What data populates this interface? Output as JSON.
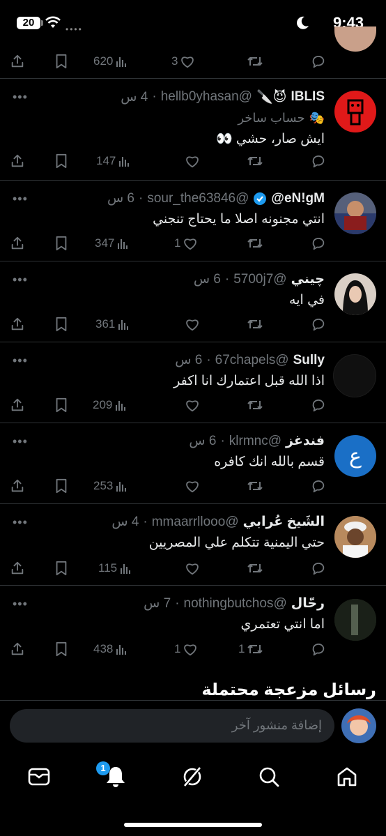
{
  "status_bar": {
    "battery": "20",
    "time": "9:43"
  },
  "tweets": [
    {
      "display_name": "IBLIS",
      "emoji": "😈🔪",
      "handle": "@hellb0yhasan",
      "time": "4 س",
      "sub_emoji": "🎭",
      "sub_text": "حساب ساخر",
      "text": "ايش صار، حشي 👀",
      "views": "147",
      "likes": "",
      "retweets": "",
      "avatar_color": "#e01919"
    },
    {
      "display_name": "eN!gM@",
      "handle": "@sour_the63846",
      "time": "6 س",
      "verified": true,
      "text": "انتي مجنونه اصلا ما يحتاج تنجني",
      "views": "347",
      "likes": "1",
      "retweets": "",
      "avatar_color": "#56607a"
    },
    {
      "display_name": "چيني",
      "handle": "@5700j7",
      "time": "6 س",
      "text": "في ايه",
      "views": "361",
      "likes": "",
      "retweets": "",
      "avatar_color": "#d9cfc6"
    },
    {
      "display_name": "Sully",
      "handle": "@67chapels",
      "time": "6 س",
      "text": "اذا الله قبل اعتمارك انا اكفر",
      "views": "209",
      "likes": "",
      "retweets": "",
      "avatar_color": "#101010"
    },
    {
      "display_name": "فندغز",
      "handle": "@klrmnc",
      "time": "6 س",
      "avatar_letter": "ع",
      "text": "قسم بالله انك كافره",
      "views": "253",
      "likes": "",
      "retweets": "",
      "avatar_color": "#1a6fc6"
    },
    {
      "display_name": "الشَيخ عُرابي",
      "handle": "@mmaarrllooo",
      "time": "4 س",
      "text": "حتي اليمنية تتكلم علي المصريين",
      "views": "115",
      "likes": "",
      "retweets": "",
      "avatar_color": "#8c6a4c"
    },
    {
      "display_name": "رحّال",
      "handle": "@nothingbutchos",
      "time": "7 س",
      "text": "اما انتي تعتمري",
      "views": "438",
      "likes": "1",
      "retweets": "1",
      "avatar_color": "#2a3326"
    }
  ],
  "top_actions": {
    "views": "620",
    "likes": "3",
    "retweets": ""
  },
  "section_title": "رسائل مزعجة محتملة",
  "compose": {
    "placeholder": "إضافة منشور آخر"
  },
  "nav": {
    "notifications_badge": "1"
  }
}
